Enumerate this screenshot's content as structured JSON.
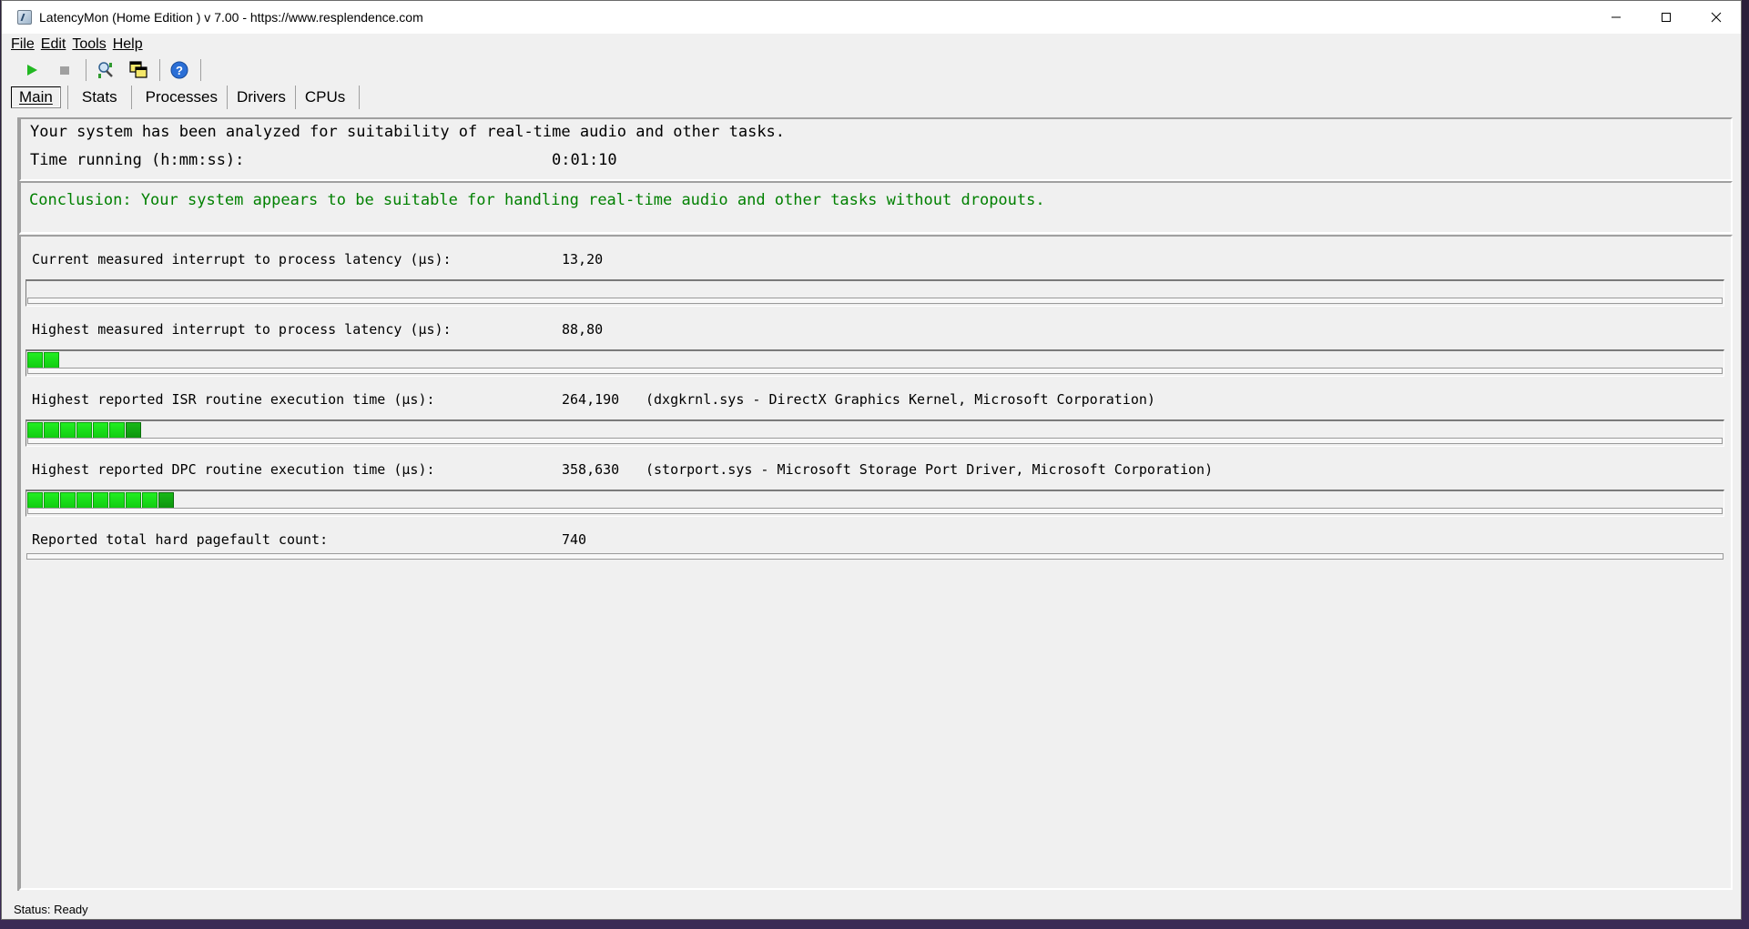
{
  "window": {
    "title": "LatencyMon  (Home Edition )  v 7.00 - https://www.resplendence.com"
  },
  "menu": {
    "file": "File",
    "edit": "Edit",
    "tools": "Tools",
    "help": "Help"
  },
  "toolbar": {
    "icons": [
      "play-icon",
      "stop-icon",
      "magnifier-chart-icon",
      "windows-cascade-icon",
      "help-icon"
    ]
  },
  "tabs": [
    {
      "label": "Main",
      "active": true
    },
    {
      "label": "Stats",
      "active": false
    },
    {
      "label": "Processes",
      "active": false
    },
    {
      "label": "Drivers",
      "active": false
    },
    {
      "label": "CPUs",
      "active": false
    }
  ],
  "summary": {
    "analyzed_text": "Your system has been analyzed for suitability of real-time audio and other tasks.",
    "time_label": "Time running (h:mm:ss):",
    "time_value": "0:01:10"
  },
  "conclusion": {
    "text": "Conclusion: Your system appears to be suitable for handling real-time audio and other tasks without dropouts.",
    "color": "#008000"
  },
  "metrics": [
    {
      "label": "Current measured interrupt to process latency (µs):",
      "value": "13,20",
      "detail": "",
      "meter_segments": 0
    },
    {
      "label": "Highest measured interrupt to process latency (µs):",
      "value": "88,80",
      "detail": "",
      "meter_segments": 2
    },
    {
      "label": "Highest reported ISR routine execution time (µs):",
      "value": "264,190",
      "detail": "(dxgkrnl.sys - DirectX Graphics Kernel, Microsoft Corporation)",
      "meter_segments": 7
    },
    {
      "label": "Highest reported DPC routine execution time (µs):",
      "value": "358,630",
      "detail": "(storport.sys - Microsoft Storage Port Driver, Microsoft Corporation)",
      "meter_segments": 9
    },
    {
      "label": "Reported total hard pagefault count:",
      "value": "740",
      "detail": "",
      "meter_segments": null
    }
  ],
  "status": {
    "text": "Status: Ready"
  },
  "colors": {
    "meter_green": "#22ee22",
    "window_bg": "#f0f0f0"
  }
}
